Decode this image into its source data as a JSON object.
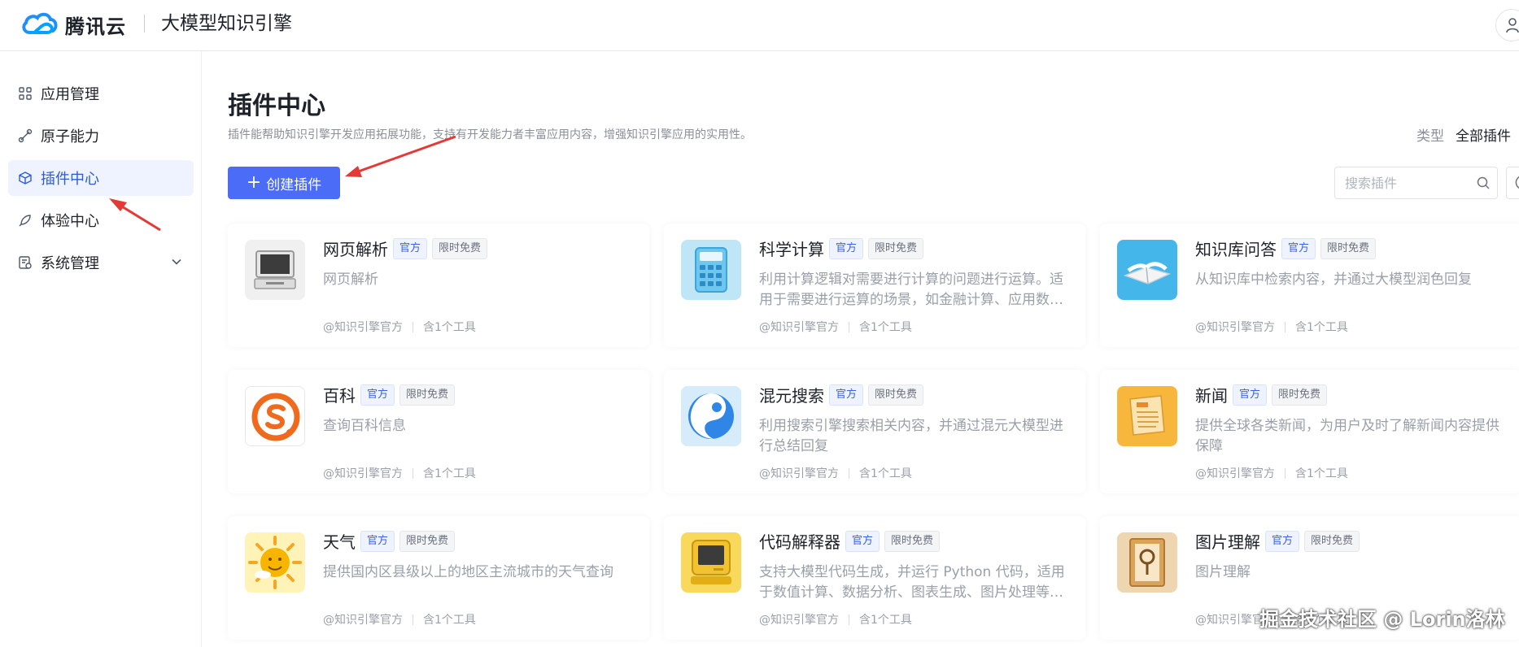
{
  "header": {
    "brand": "腾讯云",
    "product": "大模型知识引擎"
  },
  "sidebar": {
    "items": [
      {
        "label": "应用管理",
        "icon": "grid-icon"
      },
      {
        "label": "原子能力",
        "icon": "link-icon"
      },
      {
        "label": "插件中心",
        "icon": "cube-icon",
        "active": true
      },
      {
        "label": "体验中心",
        "icon": "rocket-icon"
      },
      {
        "label": "系统管理",
        "icon": "settings-doc-icon",
        "expandable": true
      }
    ]
  },
  "main": {
    "title": "插件中心",
    "description": "插件能帮助知识引擎开发应用拓展功能，支持有开发能力者丰富应用内容，增强知识引擎应用的实用性。",
    "filter": {
      "label": "类型",
      "value": "全部插件"
    },
    "create_button": "创建插件",
    "search": {
      "placeholder": "搜索插件"
    }
  },
  "plugins": [
    {
      "name": "网页解析",
      "badges": [
        "官方",
        "限时免费"
      ],
      "desc": "网页解析",
      "author": "@知识引擎官方",
      "tools": "含1个工具",
      "icon": "computer-icon"
    },
    {
      "name": "科学计算",
      "badges": [
        "官方",
        "限时免费"
      ],
      "desc": "利用计算逻辑对需要进行计算的问题进行运算。适用于需要进行运算的场景，如金融计算、应用数学计算等",
      "author": "@知识引擎官方",
      "tools": "含1个工具",
      "icon": "calculator-icon"
    },
    {
      "name": "知识库问答",
      "badges": [
        "官方",
        "限时免费"
      ],
      "desc": "从知识库中检索内容，并通过大模型润色回复",
      "author": "@知识引擎官方",
      "tools": "含1个工具",
      "icon": "book-icon"
    },
    {
      "name": "百科",
      "badges": [
        "官方",
        "限时免费"
      ],
      "desc": "查询百科信息",
      "author": "@知识引擎官方",
      "tools": "含1个工具",
      "icon": "sogou-icon"
    },
    {
      "name": "混元搜索",
      "badges": [
        "官方",
        "限时免费"
      ],
      "desc": "利用搜索引擎搜索相关内容，并通过混元大模型进行总结回复",
      "author": "@知识引擎官方",
      "tools": "含1个工具",
      "icon": "hunyuan-icon"
    },
    {
      "name": "新闻",
      "badges": [
        "官方",
        "限时免费"
      ],
      "desc": "提供全球各类新闻，为用户及时了解新闻内容提供保障",
      "author": "@知识引擎官方",
      "tools": "含1个工具",
      "icon": "newspaper-icon"
    },
    {
      "name": "天气",
      "badges": [
        "官方",
        "限时免费"
      ],
      "desc": "提供国内区县级以上的地区主流城市的天气查询",
      "author": "@知识引擎官方",
      "tools": "含1个工具",
      "icon": "sun-icon"
    },
    {
      "name": "代码解释器",
      "badges": [
        "官方",
        "限时免费"
      ],
      "desc": "支持大模型代码生成，并运行 Python 代码，适用于数值计算、数据分析、图表生成、图片处理等场景",
      "author": "@知识引擎官方",
      "tools": "含1个工具",
      "icon": "retro-computer-icon"
    },
    {
      "name": "图片理解",
      "badges": [
        "官方",
        "限时免费"
      ],
      "desc": "图片理解",
      "author": "@知识引擎官方",
      "tools": "含1个工具",
      "icon": "picture-frame-icon"
    }
  ],
  "watermark": "掘金技术社区 @ Lorin洛林"
}
